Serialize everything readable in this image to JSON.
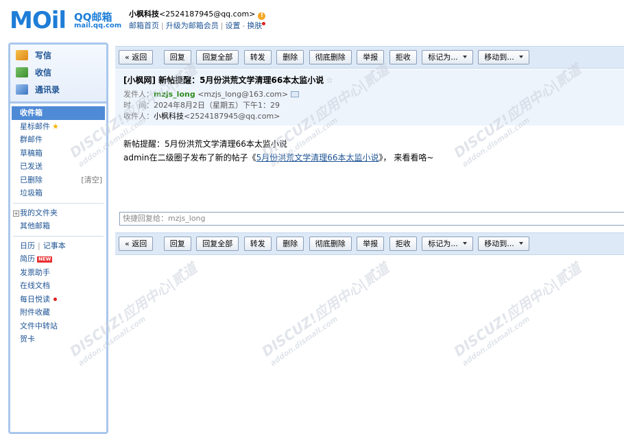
{
  "header": {
    "logo_text": "MOil",
    "logo_qq": "QQ邮箱",
    "logo_url": "mail.qq.com",
    "account_name": "小枫科技",
    "account_email": "<2524187945@qq.com>",
    "links": [
      "邮箱首页",
      "升级为邮箱会员",
      "设置",
      "换肤"
    ]
  },
  "sidebar": {
    "compose": [
      {
        "label": "写信",
        "icon": "pencil-paper-icon"
      },
      {
        "label": "收信",
        "icon": "inbox-download-icon"
      },
      {
        "label": "通讯录",
        "icon": "address-book-icon"
      }
    ],
    "folders": [
      "收件箱",
      "星标邮件",
      "群邮件",
      "草稿箱",
      "已发送",
      "已删除",
      "垃圾箱"
    ],
    "clear_label": "[清空]",
    "my_folders": "我的文件夹",
    "other_mailbox": "其他邮箱",
    "calendar": "日历",
    "notepad": "记事本",
    "tools": [
      "简历",
      "发票助手",
      "在线文档",
      "每日悦读",
      "附件收藏",
      "文件中转站",
      "贺卡"
    ],
    "new_badge": "NEW"
  },
  "toolbar": {
    "back": "« 返回",
    "reply": "回复",
    "reply_all": "回复全部",
    "forward": "转发",
    "delete": "删除",
    "delete_perm": "彻底删除",
    "report": "举报",
    "reject": "拒收",
    "mark_as": "标记为...",
    "move_to": "移动到..."
  },
  "mail": {
    "subject": "[小枫网] 新帖提醒：5月份洪荒文学清理66本太监小说",
    "sender_label": "发件人：",
    "sender_name": "mzjs_long",
    "sender_addr": "<mzjs_long@163.com>",
    "time_label": "时　间：",
    "time_value": "2024年8月2日（星期五）下午1：29",
    "to_label": "收件人：",
    "to_name": "小枫科技",
    "to_addr": "<2524187945@qq.com>",
    "body_line1": "新帖提醒：5月份洪荒文学清理66本太监小说",
    "body_line2_prefix": "admin在二级圈子发布了新的帖子《",
    "body_link": "5月份洪荒文学清理66本太监小说",
    "body_line2_suffix": "》， 来看看咯~"
  },
  "quick_reply": {
    "placeholder": "快捷回复给：mzjs_long"
  },
  "watermark": {
    "line1": "DISCUZ!应用中心|贰道",
    "line2": "addon.dismall.com"
  }
}
